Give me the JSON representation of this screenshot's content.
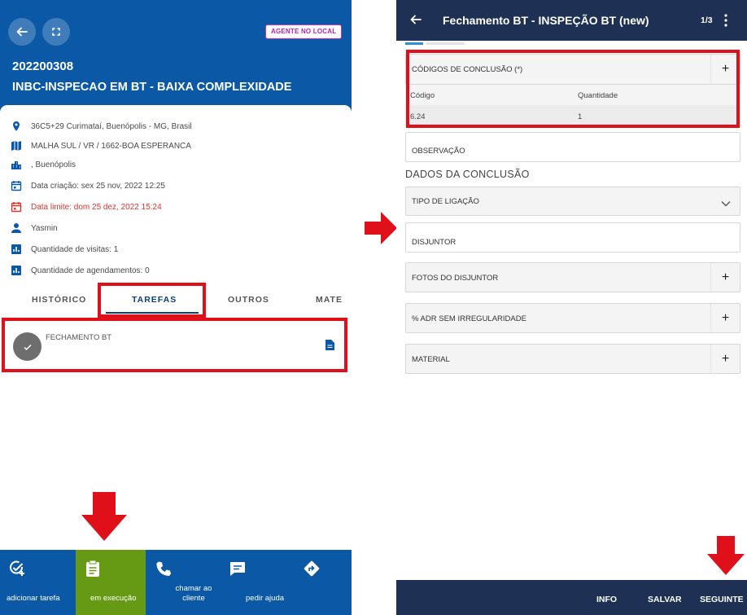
{
  "left": {
    "header": {
      "badge": "AGENTE NO LOCAL",
      "order_number": "202200308",
      "order_title": "INBC-INSPECAO EM BT - BAIXA COMPLEXIDADE",
      "back_icon": "arrow-left-icon",
      "fullscreen_icon": "fullscreen-icon"
    },
    "info": {
      "address": "36C5+29 Curimataí, Buenópolis - MG, Brasil",
      "network": "MALHA SUL / VR / 1662-BOA ESPERANCA",
      "city": ", Buenópolis",
      "created": "Data criação: sex 25 nov, 2022 12:25",
      "deadline": "Data limite: dom 25 dez, 2022 15:24",
      "user": "Yasmin",
      "visits": "Quantidade de visitas: 1",
      "schedules": "Quantidade de agendamentos: 0"
    },
    "tabs": [
      "HISTÓRICO",
      "TAREFAS",
      "OUTROS",
      "MATE"
    ],
    "active_tab": "TAREFAS",
    "task": {
      "label": "FECHAMENTO BT",
      "icon": "check-icon",
      "doc_icon": "document-icon"
    },
    "bottom_bar": {
      "items": [
        {
          "label": "adicionar tarefa",
          "icon": "add-task-icon"
        },
        {
          "label": "em execução",
          "icon": "clipboard-icon"
        },
        {
          "label": "chamar ao cliente",
          "icon": "phone-icon"
        },
        {
          "label": "pedir ajuda",
          "icon": "chat-icon"
        },
        {
          "label": "",
          "icon": "directions-icon"
        }
      ]
    },
    "colors": {
      "primary": "#0a58a6",
      "active_action": "#669a14",
      "alert": "#e0332c",
      "badge": "#b21fb6"
    }
  },
  "right": {
    "topbar": {
      "title": "Fechamento BT - INSPEÇÃO BT (new)",
      "page": "1/3",
      "back_icon": "arrow-left-icon",
      "more_icon": "more-vertical-icon"
    },
    "codes_section": {
      "label": "CÓDIGOS DE CONCLUSÃO (*)",
      "columns": [
        "Código",
        "Quantidade"
      ],
      "rows": [
        [
          "6.24",
          "1"
        ]
      ]
    },
    "observacao": "OBSERVAÇÃO",
    "dados_title": "DADOS DA CONCLUSÃO",
    "tipo_ligacao": "TIPO DE LIGAÇÃO",
    "disjuntor": "DISJUNTOR",
    "fotos_disjuntor": "FOTOS DO DISJUNTOR",
    "adr": "% ADR SEM IRREGULARIDADE",
    "material": "MATERIAL",
    "bottom": {
      "info": "INFO",
      "salvar": "SALVAR",
      "seguinte": "SEGUINTE"
    },
    "colors": {
      "bar": "#1e3154",
      "step_active": "#2c8fd6"
    }
  },
  "annotations": {
    "highlight_color": "#e0101a"
  }
}
